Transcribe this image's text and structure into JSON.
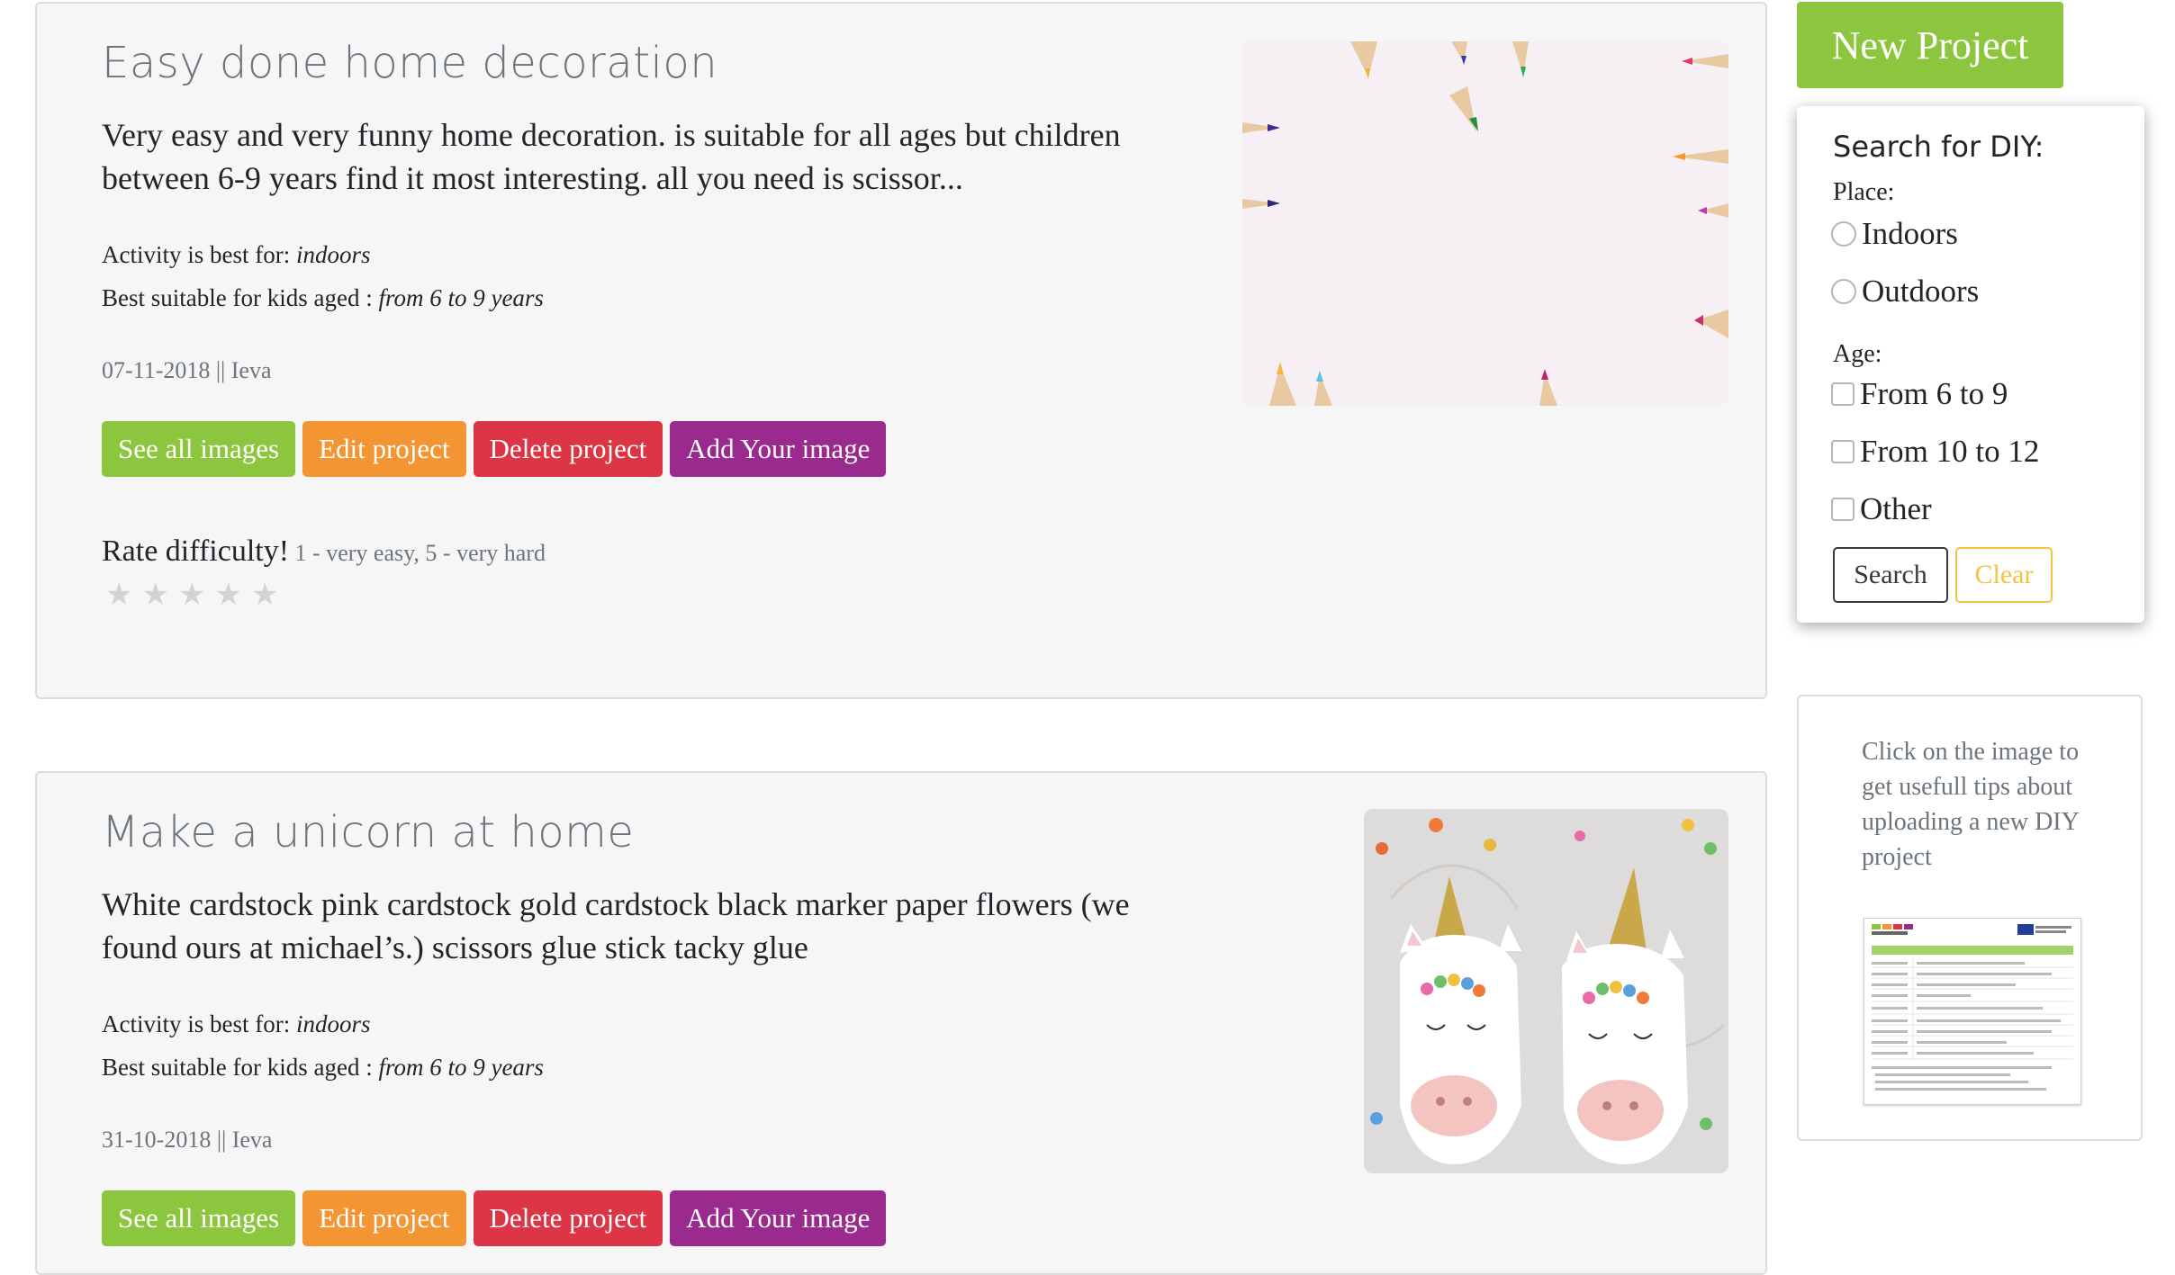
{
  "projects": [
    {
      "title": "Easy done home decoration",
      "description": "Very easy and very funny home decoration. is suitable for all ages but children between 6-9 years find it most interesting. all you need is scissor...",
      "activity_label": "Activity is best for: ",
      "activity_value": "indoors",
      "age_label": "Best suitable for kids aged : ",
      "age_value": "from 6 to 9 years",
      "date_author": "07-11-2018 || Ieva",
      "buttons": {
        "see_all": "See all images",
        "edit": "Edit project",
        "delete": "Delete project",
        "add_image": "Add Your image"
      },
      "rate_title": "Rate difficulty!",
      "rate_hint": " 1 - very easy, 5 - very hard",
      "rating": 0,
      "rating_max": 5
    },
    {
      "title": "Make a unicorn at home",
      "description": "White cardstock pink cardstock gold cardstock black marker paper flowers (we found ours at michael’s.) scissors glue stick tacky glue",
      "activity_label": "Activity is best for: ",
      "activity_value": "indoors",
      "age_label": "Best suitable for kids aged : ",
      "age_value": "from 6 to 9 years",
      "date_author": "31-10-2018 || Ieva",
      "buttons": {
        "see_all": "See all images",
        "edit": "Edit project",
        "delete": "Delete project",
        "add_image": "Add Your image"
      }
    }
  ],
  "sidebar": {
    "new_project": "New Project",
    "search": {
      "title": "Search for DIY:",
      "place_label": "Place:",
      "place_options": [
        "Indoors",
        "Outdoors"
      ],
      "age_label": "Age:",
      "age_options": [
        "From 6 to 9",
        "From 10 to 12",
        "Other"
      ],
      "search_button": "Search",
      "clear_button": "Clear"
    },
    "tips_text": "Click on the image to get usefull tips about uploading a new DIY project"
  },
  "colors": {
    "green": "#8cc63e",
    "orange": "#f39533",
    "red": "#dc3545",
    "purple": "#9b2a8e",
    "warning": "#f5c242"
  }
}
